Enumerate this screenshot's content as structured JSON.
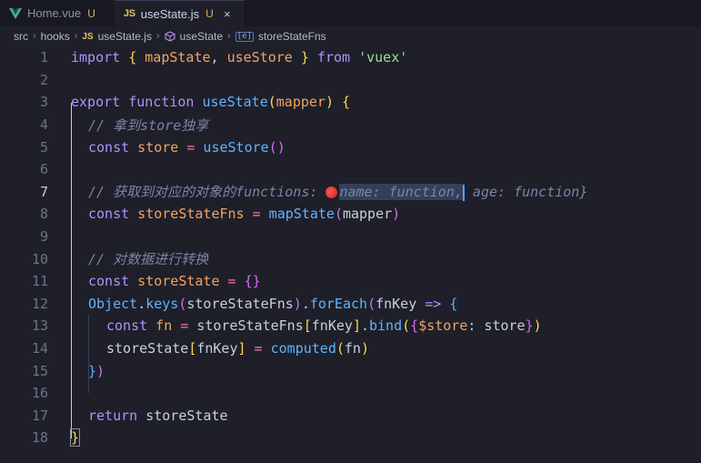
{
  "tabs": [
    {
      "label": "Home.vue",
      "status": "U",
      "icon": "vue-icon",
      "active": false
    },
    {
      "label": "useState.js",
      "status": "U",
      "icon": "js-icon",
      "active": true,
      "close": "×"
    }
  ],
  "breadcrumb": {
    "segments": [
      "src",
      "hooks",
      "useState.js",
      "useState",
      "storeStateFns"
    ],
    "js_badge": "JS",
    "var_badge": "[e]",
    "separator": "›"
  },
  "editor": {
    "line_numbers": [
      "1",
      "2",
      "3",
      "4",
      "5",
      "6",
      "7",
      "8",
      "9",
      "10",
      "11",
      "12",
      "13",
      "14",
      "15",
      "16",
      "17",
      "18"
    ],
    "current_line": 7,
    "colors": {
      "keyword": "#b191ff",
      "function": "#5fb4ff",
      "variable": "#f4a35e",
      "string": "#9ee28a",
      "comment": "#7c84a8"
    }
  },
  "code": {
    "l1": {
      "import": "import",
      "ob": "{",
      "s1": " mapState",
      "comma": ",",
      "s2": " useStore ",
      "cb": "}",
      "from": " from ",
      "str": "'vuex'"
    },
    "l3": {
      "export": "export",
      "function": " function ",
      "name": "useState",
      "op": "(",
      "param": "mapper",
      "cp": ")",
      "ob": " {"
    },
    "l4": {
      "comment": "// 拿到store独享"
    },
    "l5": {
      "const": "const",
      "var": " store ",
      "eq": "=",
      "fn": " useStore",
      "paren": "()"
    },
    "l7": {
      "comment": "// 获取到对应的对象的functions: ",
      "hint_sel": "name: function,",
      "hint_rest": " age: function}"
    },
    "l8": {
      "const": "const",
      "var": " storeStateFns ",
      "eq": "=",
      "fn": " mapState",
      "op": "(",
      "param": "mapper",
      "cp": ")"
    },
    "l10": {
      "comment": "// 对数据进行转换"
    },
    "l11": {
      "const": "const",
      "var": " storeState ",
      "eq": "=",
      "obj": " {}"
    },
    "l12": {
      "obj": "Object",
      "dot": ".",
      "keys": "keys",
      "op": "(",
      "arg": "storeStateFns",
      "cp": ")",
      "dot2": ".",
      "each": "forEach",
      "op2": "(",
      "param": "fnKey",
      "arrow": " =>",
      "ob": " {"
    },
    "l13": {
      "const": "const",
      "var": " fn ",
      "eq": "=",
      "obj": " storeStateFns",
      "lb": "[",
      "key": "fnKey",
      "rb": "]",
      "dot": ".",
      "bind": "bind",
      "op": "(",
      "ob": "{",
      "prop": "$store",
      "colon": ": ",
      "val": "store",
      "cb": "}",
      "cp": ")"
    },
    "l14": {
      "obj": "storeState",
      "lb": "[",
      "key": "fnKey",
      "rb": "]",
      "eq": " = ",
      "fn": "computed",
      "op": "(",
      "arg": "fn",
      "cp": ")"
    },
    "l15": {
      "cb": "}",
      "cp": ")"
    },
    "l17": {
      "ret": "return",
      "var": " storeState"
    },
    "l18": {
      "cb": "}"
    }
  }
}
